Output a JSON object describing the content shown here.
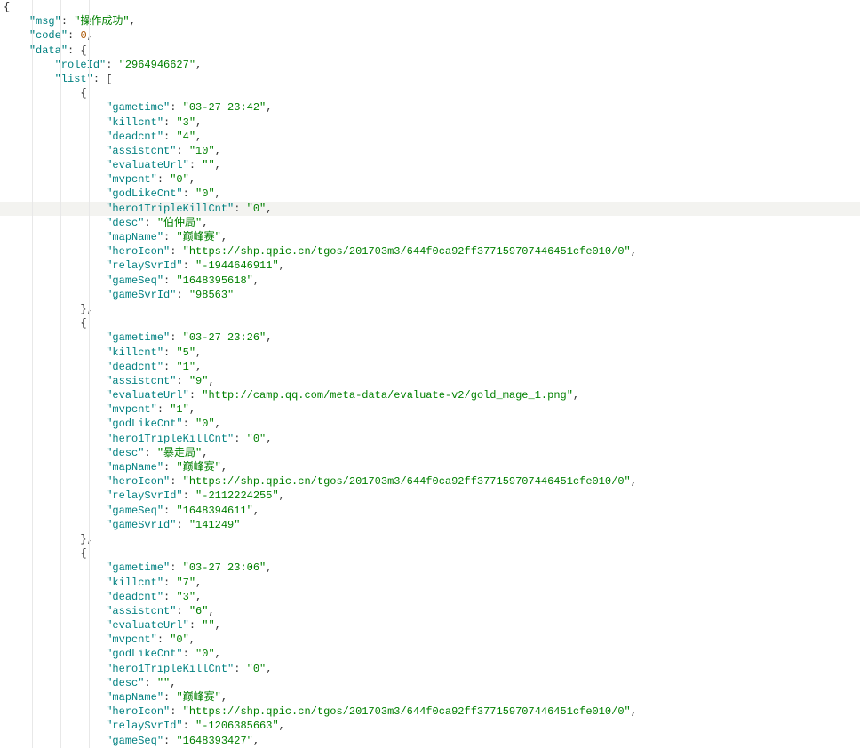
{
  "json": {
    "msg": "操作成功",
    "code": 0,
    "data": {
      "roleId": "2964946627",
      "list": [
        {
          "gametime": "03-27 23:42",
          "killcnt": "3",
          "deadcnt": "4",
          "assistcnt": "10",
          "evaluateUrl": "",
          "mvpcnt": "0",
          "godLikeCnt": "0",
          "hero1TripleKillCnt": "0",
          "desc": "伯仲局",
          "mapName": "巅峰赛",
          "heroIcon": "https://shp.qpic.cn/tgos/201703m3/644f0ca92ff377159707446451cfe010/0",
          "relaySvrId": "-1944646911",
          "gameSeq": "1648395618",
          "gameSvrId": "98563"
        },
        {
          "gametime": "03-27 23:26",
          "killcnt": "5",
          "deadcnt": "1",
          "assistcnt": "9",
          "evaluateUrl": "http://camp.qq.com/meta-data/evaluate-v2/gold_mage_1.png",
          "mvpcnt": "1",
          "godLikeCnt": "0",
          "hero1TripleKillCnt": "0",
          "desc": "暴走局",
          "mapName": "巅峰赛",
          "heroIcon": "https://shp.qpic.cn/tgos/201703m3/644f0ca92ff377159707446451cfe010/0",
          "relaySvrId": "-2112224255",
          "gameSeq": "1648394611",
          "gameSvrId": "141249"
        },
        {
          "gametime": "03-27 23:06",
          "killcnt": "7",
          "deadcnt": "3",
          "assistcnt": "6",
          "evaluateUrl": "",
          "mvpcnt": "0",
          "godLikeCnt": "0",
          "hero1TripleKillCnt": "0",
          "desc": "",
          "mapName": "巅峰赛",
          "heroIcon": "https://shp.qpic.cn/tgos/201703m3/644f0ca92ff377159707446451cfe010/0",
          "relaySvrId": "-1206385663",
          "gameSeq": "1648393427"
        }
      ]
    }
  },
  "highlight_line_text": "hero1TripleKillCnt"
}
